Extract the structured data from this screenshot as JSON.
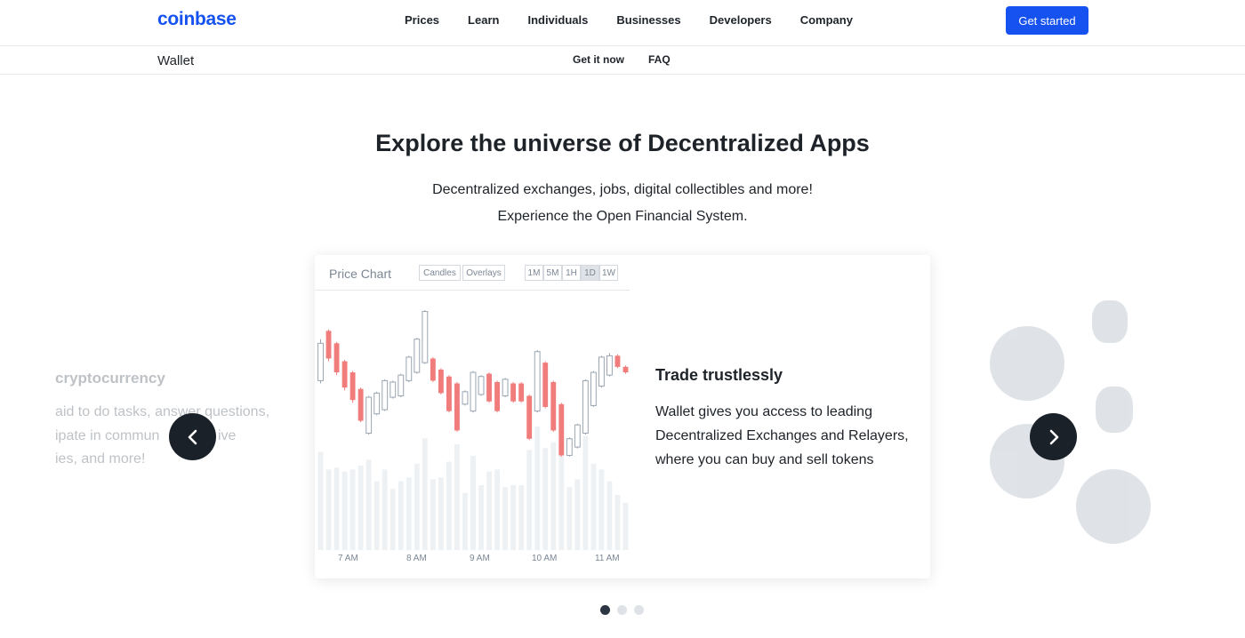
{
  "header": {
    "logo": "coinbase",
    "nav": [
      "Prices",
      "Learn",
      "Individuals",
      "Businesses",
      "Developers",
      "Company"
    ],
    "cta": "Get started",
    "brand_color": "#1652f0"
  },
  "subnav": {
    "title": "Wallet",
    "links": [
      "Get it now",
      "FAQ"
    ]
  },
  "hero": {
    "title": "Explore the universe of Decentralized Apps",
    "subtitle_lines": [
      "Decentralized exchanges, jobs, digital collectibles and more!",
      "Experience the Open Financial System."
    ]
  },
  "carousel": {
    "prev_icon": "chevron-left-icon",
    "next_icon": "chevron-right-icon",
    "left_slide": {
      "title": "cryptocurrency",
      "lines": [
        "aid to do tasks, answer questions,",
        "ipate in commun",
        "ive",
        "ies, and more!"
      ]
    },
    "active_slide": {
      "title": "Trade trustlessly",
      "body": "Wallet gives you access to leading Decentralized Exchanges and Relayers, where you can buy and sell tokens"
    },
    "dots": 3,
    "active_dot": 0
  },
  "price_chart": {
    "title": "Price Chart",
    "modes": [
      "Candles",
      "Overlays"
    ],
    "ranges": [
      "1M",
      "5M",
      "1H",
      "1D",
      "1W"
    ],
    "active_range": "1D",
    "up_color": "#ffffff",
    "down_color": "#f07c7c",
    "outline_color": "#9aa5b1"
  },
  "chart_data": {
    "type": "candlestick",
    "x_ticks": [
      "7 AM",
      "8 AM",
      "9 AM",
      "10 AM",
      "11 AM"
    ],
    "candles": [
      {
        "o": 4.8,
        "c": 7.5,
        "h": 7.8,
        "l": 4.6
      },
      {
        "o": 8.4,
        "c": 6.4,
        "h": 8.5,
        "l": 6.2
      },
      {
        "o": 7.5,
        "c": 5.4,
        "h": 7.6,
        "l": 5.2
      },
      {
        "o": 6.2,
        "c": 4.3,
        "h": 6.3,
        "l": 4.1
      },
      {
        "o": 5.4,
        "c": 3.4,
        "h": 5.5,
        "l": 3.2
      },
      {
        "o": 4.2,
        "c": 1.9,
        "h": 4.3,
        "l": 1.8
      },
      {
        "o": 1.0,
        "c": 3.6,
        "h": 3.7,
        "l": 0.9
      },
      {
        "o": 2.4,
        "c": 3.9,
        "h": 4.0,
        "l": 2.3
      },
      {
        "o": 2.7,
        "c": 4.8,
        "h": 4.9,
        "l": 2.6
      },
      {
        "o": 3.6,
        "c": 4.7,
        "h": 4.8,
        "l": 3.5
      },
      {
        "o": 3.7,
        "c": 5.2,
        "h": 5.3,
        "l": 3.6
      },
      {
        "o": 4.8,
        "c": 6.5,
        "h": 6.6,
        "l": 4.7
      },
      {
        "o": 5.4,
        "c": 7.8,
        "h": 7.9,
        "l": 5.3
      },
      {
        "o": 6.1,
        "c": 9.8,
        "h": 9.9,
        "l": 6.0
      },
      {
        "o": 6.4,
        "c": 4.8,
        "h": 6.5,
        "l": 4.7
      },
      {
        "o": 5.6,
        "c": 3.9,
        "h": 5.7,
        "l": 3.8
      },
      {
        "o": 5.1,
        "c": 2.6,
        "h": 5.2,
        "l": 2.5
      },
      {
        "o": 4.6,
        "c": 1.2,
        "h": 4.7,
        "l": 1.1
      },
      {
        "o": 3.1,
        "c": 4.0,
        "h": 4.1,
        "l": 3.0
      },
      {
        "o": 2.6,
        "c": 5.4,
        "h": 5.5,
        "l": 2.5
      },
      {
        "o": 3.8,
        "c": 5.1,
        "h": 5.2,
        "l": 3.7
      },
      {
        "o": 5.3,
        "c": 3.3,
        "h": 5.4,
        "l": 3.2
      },
      {
        "o": 4.7,
        "c": 2.6,
        "h": 4.8,
        "l": 2.5
      },
      {
        "o": 3.7,
        "c": 4.9,
        "h": 5.0,
        "l": 3.6
      },
      {
        "o": 4.6,
        "c": 3.3,
        "h": 4.7,
        "l": 3.2
      },
      {
        "o": 4.6,
        "c": 3.3,
        "h": 4.7,
        "l": 3.2
      },
      {
        "o": 3.7,
        "c": 0.6,
        "h": 3.8,
        "l": 0.5
      },
      {
        "o": 2.6,
        "c": 6.9,
        "h": 7.0,
        "l": 2.5
      },
      {
        "o": 6.1,
        "c": 2.9,
        "h": 6.2,
        "l": 2.8
      },
      {
        "o": 4.7,
        "c": 1.2,
        "h": 4.8,
        "l": 1.1
      },
      {
        "o": 3.1,
        "c": -0.6,
        "h": 3.2,
        "l": -0.7
      },
      {
        "o": -0.6,
        "c": 0.6,
        "h": 0.7,
        "l": -0.7
      },
      {
        "o": 0.0,
        "c": 1.6,
        "h": 1.7,
        "l": -0.1
      },
      {
        "o": 1.0,
        "c": 4.8,
        "h": 4.9,
        "l": 0.9
      },
      {
        "o": 3.0,
        "c": 5.4,
        "h": 5.5,
        "l": 2.9
      },
      {
        "o": 4.4,
        "c": 6.5,
        "h": 6.6,
        "l": 4.3
      },
      {
        "o": 5.2,
        "c": 6.6,
        "h": 6.8,
        "l": 5.1
      },
      {
        "o": 6.6,
        "c": 5.8,
        "h": 6.7,
        "l": 5.7
      },
      {
        "o": 5.8,
        "c": 5.4,
        "h": 5.9,
        "l": 5.3
      }
    ],
    "volume_note": "volume bars shown faintly below the candles"
  }
}
